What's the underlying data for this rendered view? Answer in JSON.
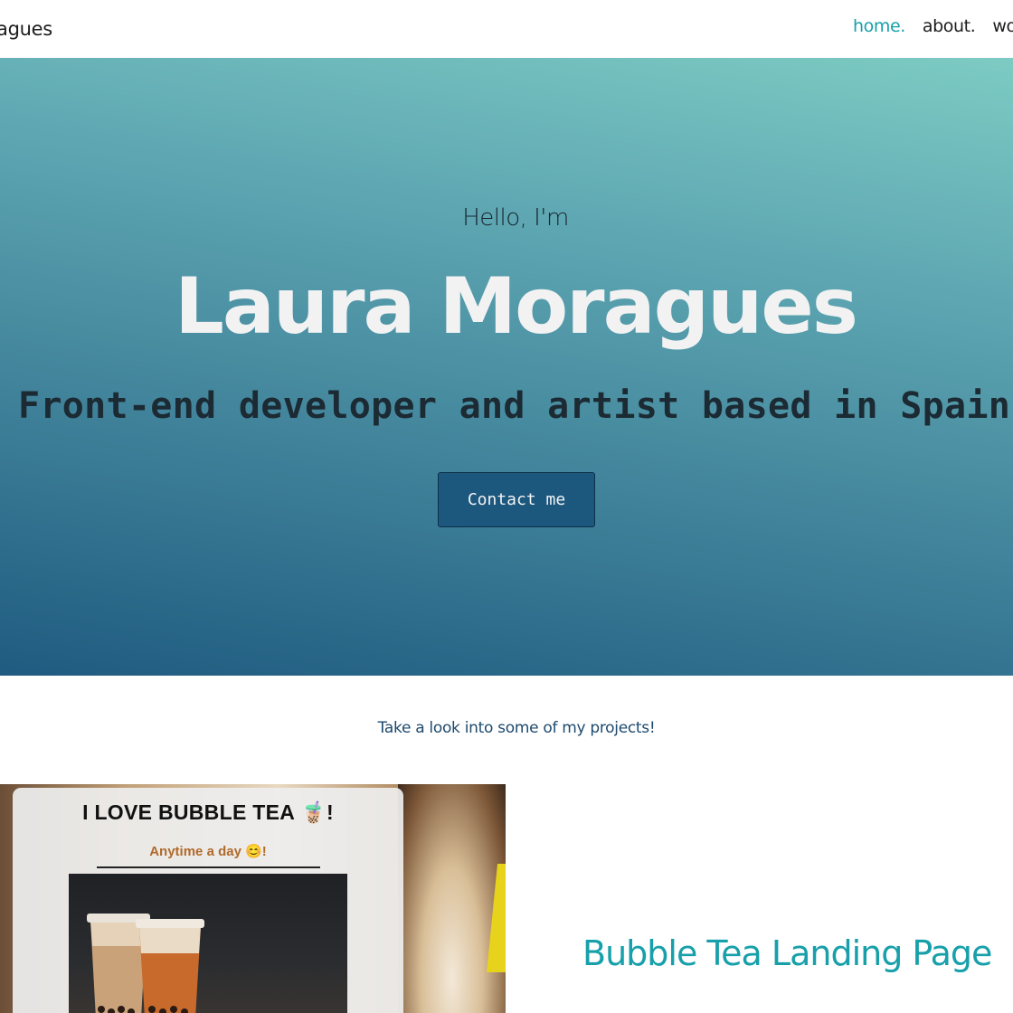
{
  "header": {
    "brand": "agues",
    "nav": [
      {
        "label": "home.",
        "active": true
      },
      {
        "label": "about.",
        "active": false
      },
      {
        "label": "wo",
        "active": false
      }
    ]
  },
  "hero": {
    "greeting": "Hello, I'm",
    "name": "Laura Moragues",
    "tagline": "Front-end developer and artist based in Spain",
    "cta_label": "Contact me"
  },
  "projects": {
    "intro": "Take a look into some of my projects!",
    "items": [
      {
        "title": "Bubble Tea Landing Page",
        "thumbnail": {
          "heading": "I LOVE BUBBLE TEA 🧋!",
          "subheading": "Anytime a day 😊!"
        }
      }
    ]
  },
  "colors": {
    "accent": "#17a0aa",
    "button": "#1c577e",
    "intro_text": "#1d4a6e"
  }
}
